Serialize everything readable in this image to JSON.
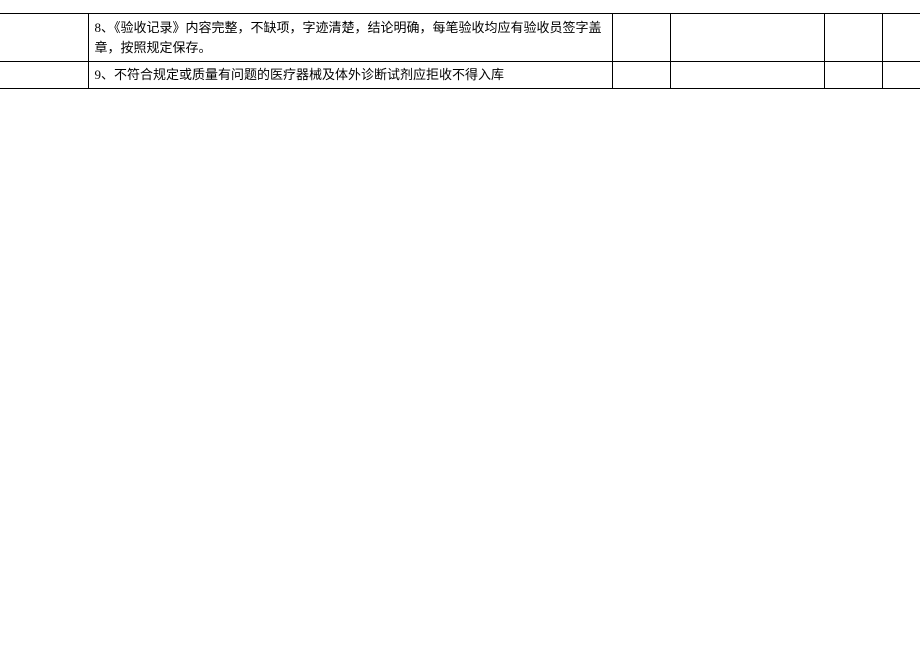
{
  "table": {
    "rows": [
      {
        "content": "8、《验收记录》内容完整，不缺项，字迹清楚，结论明确，每笔验收均应有验收员签字盖章，按照规定保存。",
        "c3": "",
        "c4": "",
        "c5": "",
        "c6": ""
      },
      {
        "content": "9、不符合规定或质量有问题的医疗器械及体外诊断试剂应拒收不得入库",
        "c3": "",
        "c4": "",
        "c5": "",
        "c6": ""
      }
    ]
  }
}
